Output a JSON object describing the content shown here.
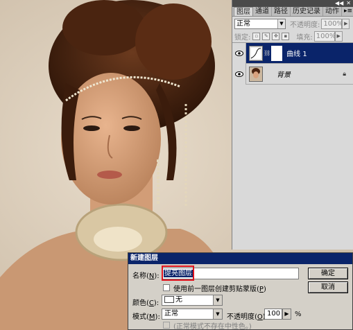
{
  "panel": {
    "tabs": [
      "图层",
      "通道",
      "路径",
      "历史记录",
      "动作"
    ],
    "blend_mode": "正常",
    "opacity_label": "不透明度:",
    "opacity_value": "100%",
    "lock_label": "锁定:",
    "fill_label": "填充:",
    "fill_value": "100%",
    "layers": [
      {
        "name": "曲线 1",
        "selected": true
      },
      {
        "name": "背景",
        "selected": false
      }
    ]
  },
  "dialog": {
    "title": "新建图层",
    "name_label": "名称(",
    "name_key": "N",
    "name_label_end": "):",
    "name_value": "提亮图层",
    "ok_button": "确定",
    "cancel_button": "取消",
    "clip_label": "使用前一图层创建剪贴蒙版(",
    "clip_key": "P",
    "clip_label_end": ")",
    "color_label": "颜色(",
    "color_key": "C",
    "color_label_end": "):",
    "color_value": "无",
    "mode_label": "模式(",
    "mode_key": "M",
    "mode_label_end": "):",
    "mode_value": "正常",
    "opacity_label": "不透明度(",
    "opacity_key": "O",
    "opacity_label_end": "):",
    "opacity_value": "100",
    "percent": "%",
    "neutral_note": "(正常模式不存在中性色。)"
  },
  "colors": {
    "selection": "#0a246a",
    "highlight_frame": "#e0141e",
    "panel_bg": "#d9d9d9",
    "dialog_bg": "#d4d0c8"
  }
}
